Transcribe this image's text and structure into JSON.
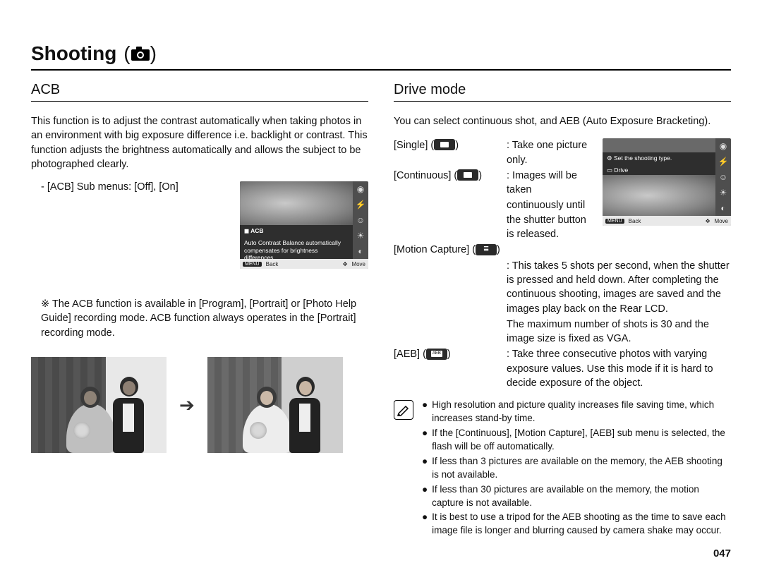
{
  "page": {
    "section_title": "Shooting",
    "section_paren_open": "(",
    "section_paren_close": ")",
    "page_number": "047"
  },
  "left": {
    "subhead": "ACB",
    "intro": "This function is to adjust the contrast automatically when taking photos in an environment with big exposure difference i.e. backlight or contrast. This function adjusts the brightness automatically and allows the subject to be photographed clearly.",
    "submenu": "- [ACB] Sub menus: [Off], [On]",
    "lcd": {
      "title": "ACB",
      "desc": "Auto Contrast Balance automatically compensates for brightness differences.",
      "back": "Back",
      "move": "Move",
      "menu_tag": "MENU"
    },
    "note_prefix": "※ ",
    "note": "The ACB function is available in [Program], [Portrait] or [Photo Help Guide] recording mode. ACB function always operates in the [Portrait] recording mode."
  },
  "right": {
    "subhead": "Drive mode",
    "intro": "You can select continuous shot, and AEB (Auto Exposure Bracketing).",
    "modes": {
      "single": {
        "label": "[Single]",
        "desc": ": Take one picture only."
      },
      "continuous": {
        "label": "[Continuous]",
        "desc_line1": ": Images will be taken",
        "desc_rest": "continuously until the shutter button is released."
      },
      "motion": {
        "label": "[Motion Capture]",
        "desc_line1": ": This takes 5 shots per",
        "desc_rest": "second, when the shutter is pressed and held down. After completing the continuous shooting, images are saved and the images play back on the Rear LCD.",
        "extra": "The maximum number of shots is 30 and the image size is fixed as VGA."
      },
      "aeb": {
        "label": "[AEB]",
        "desc": ": Take three consecutive photos with varying exposure values. Use this mode if it is hard to decide exposure of the object."
      }
    },
    "lcd": {
      "title": "Set the shooting type.",
      "desc": "Drive",
      "back": "Back",
      "move": "Move",
      "menu_tag": "MENU"
    },
    "notes": [
      "High resolution and picture quality increases file saving time, which increases stand-by time.",
      "If the [Continuous], [Motion Capture], [AEB] sub menu is selected, the flash will be off automatically.",
      "If less than 3 pictures are available on the memory, the AEB shooting is not available.",
      "If less than 30 pictures are available on the memory, the motion capture is not available.",
      "It is best to use a tripod for the AEB shooting as the time to save each image file is longer and blurring caused by camera shake may occur."
    ]
  }
}
